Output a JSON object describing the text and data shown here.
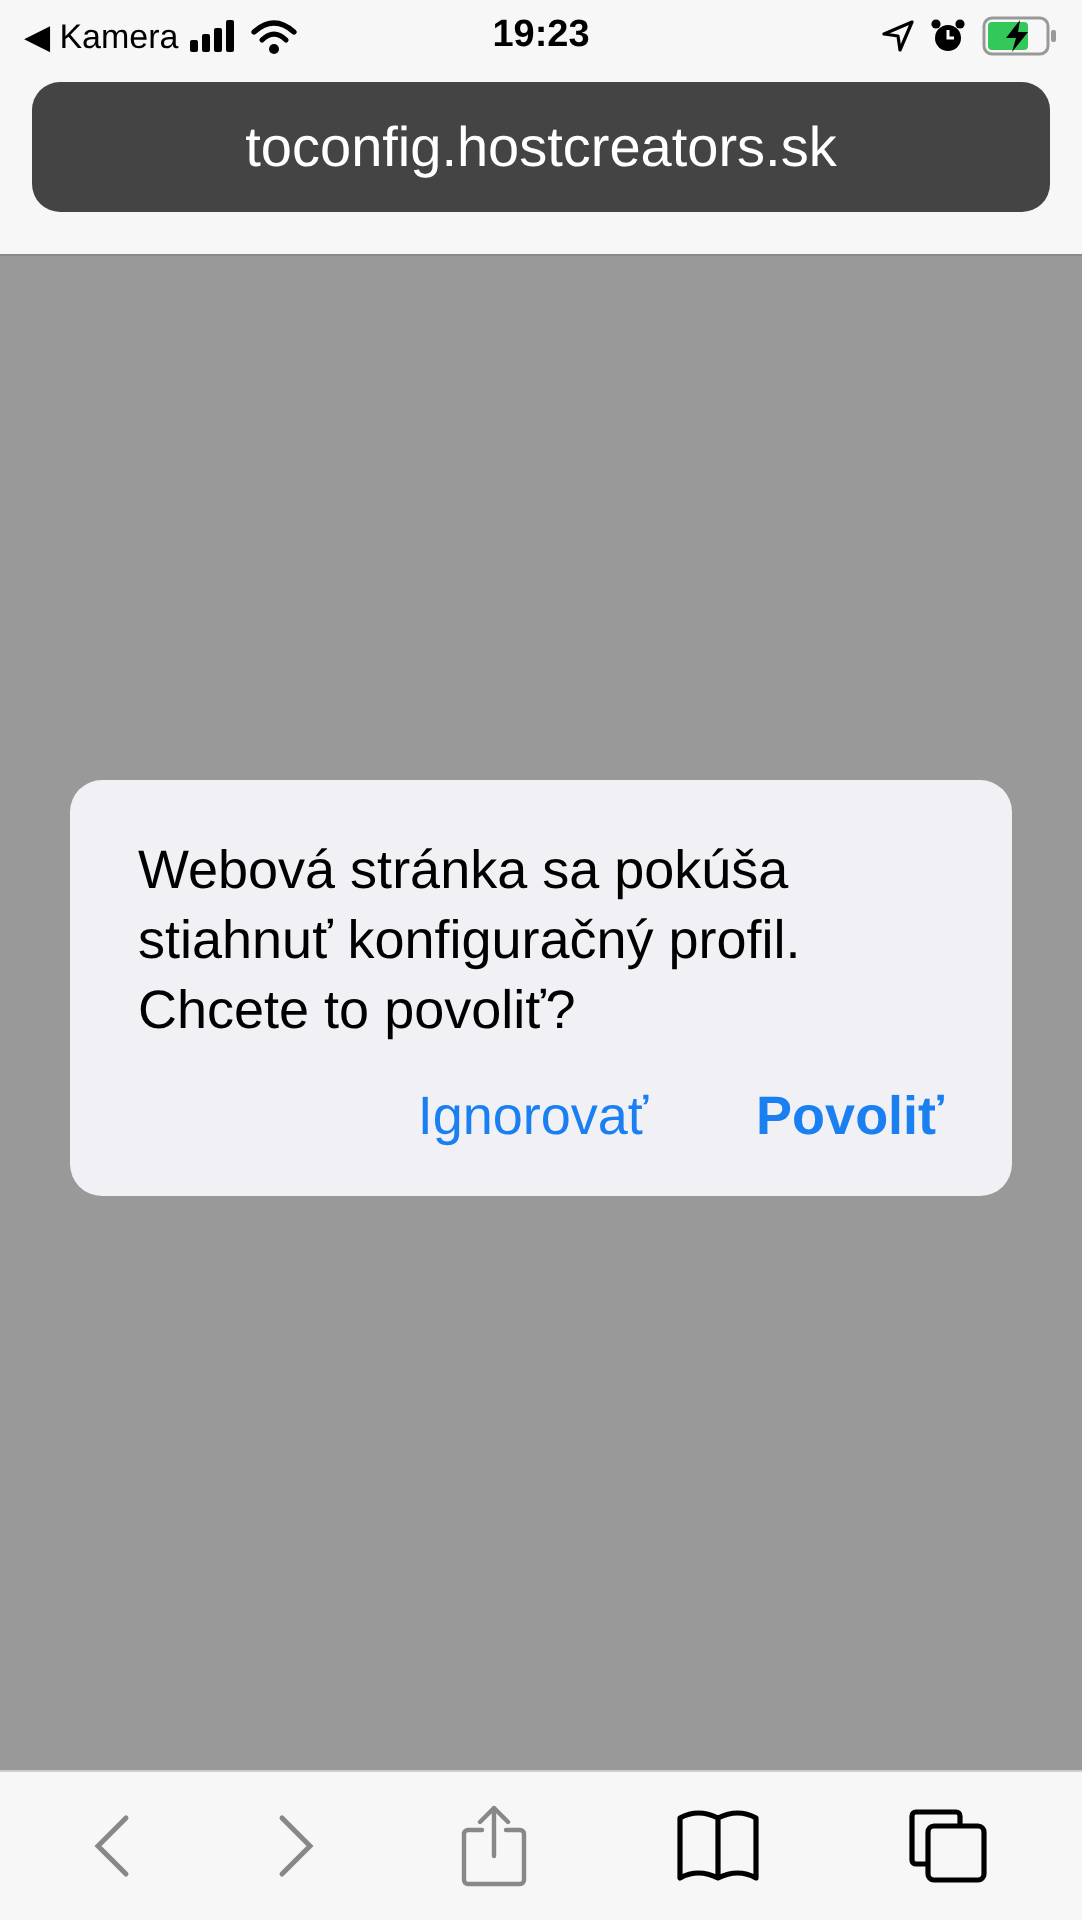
{
  "status_bar": {
    "back_app": "◀ Kamera",
    "time": "19:23"
  },
  "address_bar": {
    "url": "toconfig.hostcreators.sk"
  },
  "alert": {
    "message": "Webová stránka sa pokúša stiahnuť konfiguračný profil. Chcete to povoliť?",
    "buttons": [
      {
        "label": "Ignorovať",
        "kind": "cancel"
      },
      {
        "label": "Povoliť",
        "kind": "default"
      }
    ]
  },
  "toolbar": [
    {
      "kind": "back",
      "disabled": true
    },
    {
      "kind": "forward",
      "disabled": true
    },
    {
      "kind": "share",
      "disabled": true
    },
    {
      "kind": "bookmarks",
      "disabled": false
    },
    {
      "kind": "tabs",
      "disabled": false
    }
  ]
}
